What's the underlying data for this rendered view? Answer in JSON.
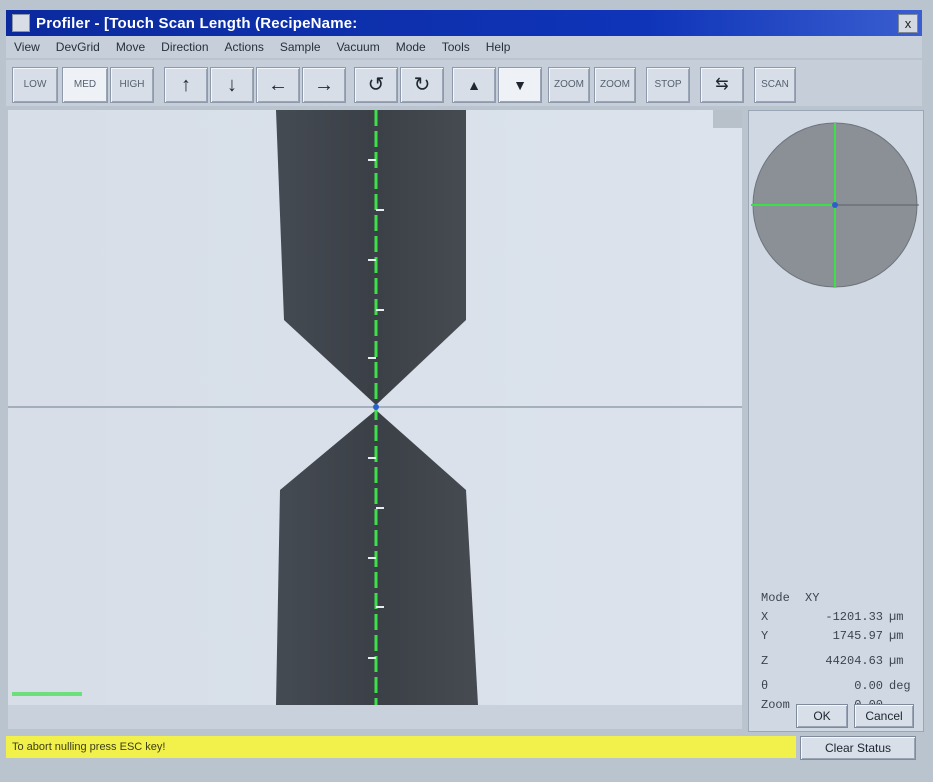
{
  "window": {
    "title": "Profiler - [Touch Scan Length (RecipeName:",
    "close_glyph": "x"
  },
  "menu": [
    "View",
    "DevGrid",
    "Move",
    "Direction",
    "Actions",
    "Sample",
    "Vacuum",
    "Mode",
    "Tools",
    "Help"
  ],
  "toolbar": {
    "buttons": [
      {
        "label": "LOW",
        "icon": ""
      },
      {
        "label": "MED",
        "icon": ""
      },
      {
        "label": "HIGH",
        "icon": ""
      },
      {
        "label": "",
        "icon": "arrow-up-icon"
      },
      {
        "label": "",
        "icon": "arrow-down-icon"
      },
      {
        "label": "",
        "icon": "arrow-left-icon"
      },
      {
        "label": "",
        "icon": "arrow-right-icon"
      },
      {
        "label": "",
        "icon": "rotate-ccw-icon"
      },
      {
        "label": "",
        "icon": "rotate-cw-icon"
      },
      {
        "label": "",
        "icon": "focus-up-icon"
      },
      {
        "label": "",
        "icon": "focus-down-icon"
      },
      {
        "label": "ZOOM",
        "icon": ""
      },
      {
        "label": "ZOOM",
        "icon": ""
      },
      {
        "label": "STOP",
        "icon": ""
      },
      {
        "label": "",
        "icon": "swap-icon"
      },
      {
        "label": "SCAN",
        "icon": ""
      }
    ]
  },
  "readout": {
    "mode_label": "Mode",
    "mode_value": "XY",
    "x_label": "X",
    "x_value": "-1201.33",
    "x_unit": "µm",
    "y_label": "Y",
    "y_value": "1745.97",
    "y_unit": "µm",
    "z_label": "Z",
    "z_value": "44204.63",
    "z_unit": "µm",
    "theta_label": "θ",
    "theta_value": "0.00",
    "theta_unit": "deg",
    "zoom_label": "Zoom",
    "zoom_value": "0.00"
  },
  "buttons": {
    "ok": "OK",
    "cancel": "Cancel",
    "clear_status": "Clear Status"
  },
  "status": {
    "message": "To abort nulling press ESC key!"
  },
  "colors": {
    "accent_green": "#3ee04a",
    "status_yellow": "#f2f04a",
    "title_blue": "#0f34b8"
  }
}
